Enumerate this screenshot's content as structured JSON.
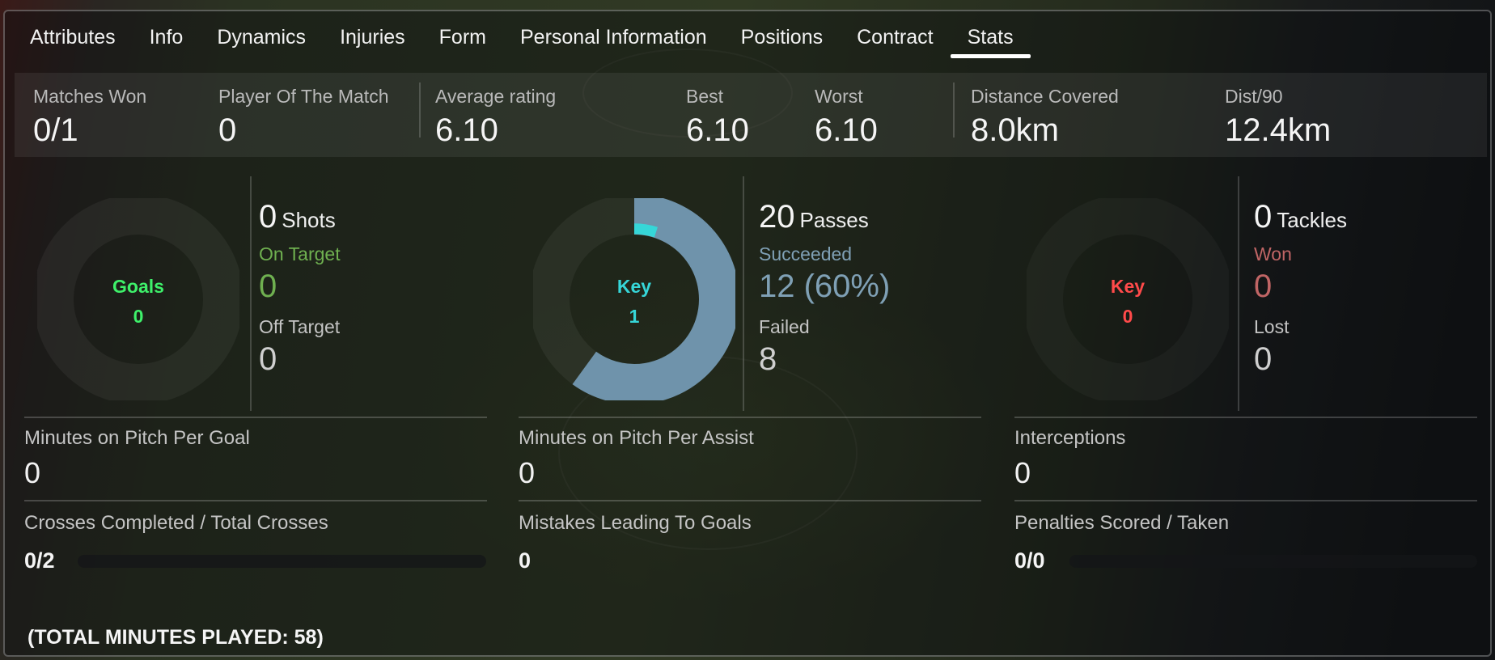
{
  "tabs": [
    "Attributes",
    "Info",
    "Dynamics",
    "Injuries",
    "Form",
    "Personal Information",
    "Positions",
    "Contract",
    "Stats"
  ],
  "active_tab": "Stats",
  "summary": {
    "matches_won": {
      "label": "Matches Won",
      "value": "0/1"
    },
    "potm": {
      "label": "Player Of The Match",
      "value": "0"
    },
    "avg": {
      "label": "Average rating",
      "value": "6.10"
    },
    "best": {
      "label": "Best",
      "value": "6.10"
    },
    "worst": {
      "label": "Worst",
      "value": "6.10"
    },
    "distance": {
      "label": "Distance Covered",
      "value": "8.0km"
    },
    "dist90": {
      "label": "Dist/90",
      "value": "12.4km"
    }
  },
  "shooting": {
    "donut": {
      "key": "Goals",
      "value": "0",
      "color": "#3ef06a"
    },
    "count": "0",
    "title": "Shots",
    "on_label": "On Target",
    "on_value": "0",
    "on_color": "#6fb050",
    "off_label": "Off Target",
    "off_value": "0"
  },
  "passing": {
    "donut": {
      "key": "Key",
      "value": "1",
      "color": "#36d6d8",
      "ring_color": "#6f93ab",
      "fraction": 0.6,
      "key_fraction": 0.05
    },
    "count": "20",
    "title": "Passes",
    "on_label": "Succeeded",
    "on_value": "12 (60%)",
    "on_color": "#7fa0b5",
    "off_label": "Failed",
    "off_value": "8"
  },
  "defending": {
    "donut": {
      "key": "Key",
      "value": "0",
      "color": "#ff4a4a"
    },
    "count": "0",
    "title": "Tackles",
    "on_label": "Won",
    "on_value": "0",
    "on_color": "#c06565",
    "off_label": "Lost",
    "off_value": "0"
  },
  "bottom": {
    "mins_goal": {
      "label": "Minutes on Pitch Per Goal",
      "value": "0"
    },
    "mins_assist": {
      "label": "Minutes on Pitch Per Assist",
      "value": "0"
    },
    "interceptions": {
      "label": "Interceptions",
      "value": "0"
    },
    "crosses": {
      "label": "Crosses Completed / Total Crosses",
      "value": "0/2",
      "fraction": 0
    },
    "mistakes": {
      "label": "Mistakes Leading To Goals",
      "value": "0"
    },
    "penalties": {
      "label": "Penalties Scored / Taken",
      "value": "0/0",
      "fraction": 0
    }
  },
  "total_minutes": "(TOTAL MINUTES PLAYED: 58)"
}
